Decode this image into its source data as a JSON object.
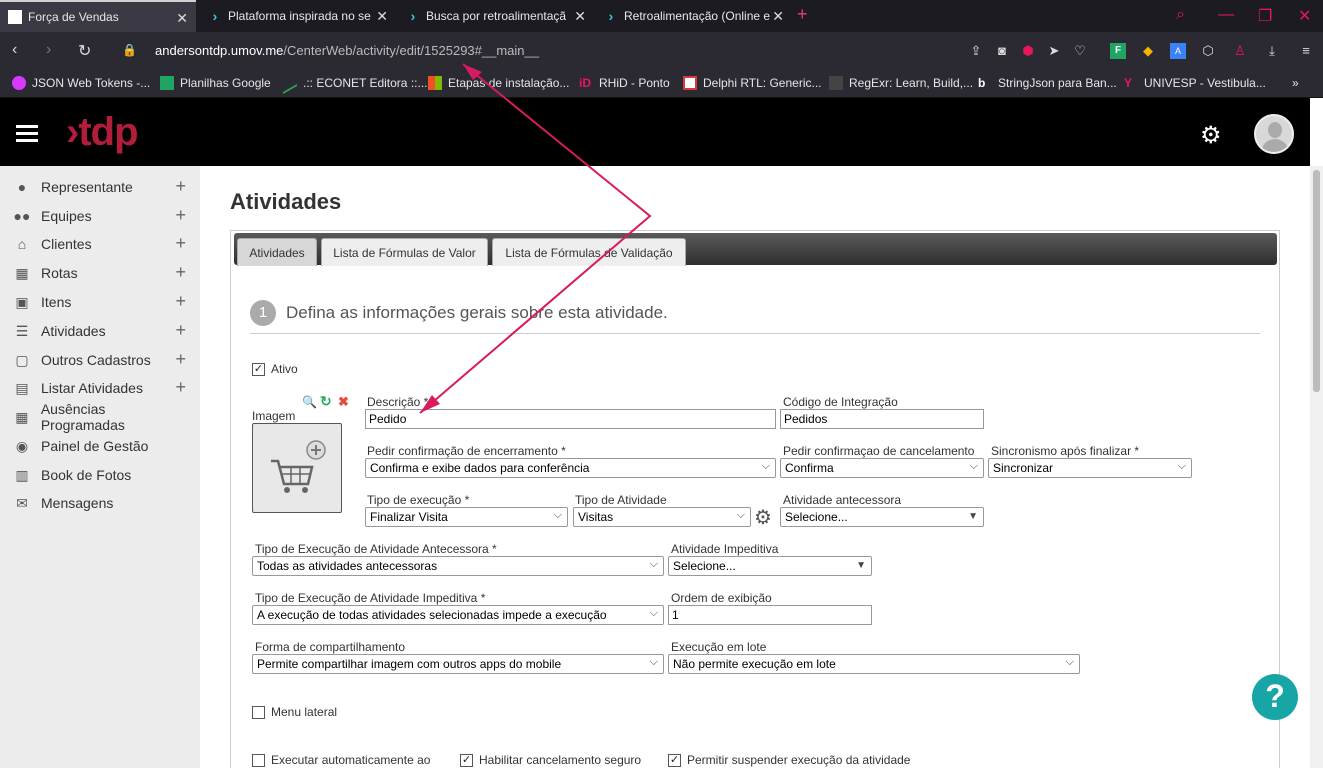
{
  "browser": {
    "tabs": [
      {
        "title": "Força de Vendas",
        "active": true
      },
      {
        "title": "Plataforma inspirada no se",
        "active": false
      },
      {
        "title": "Busca por retroalimentaçã",
        "active": false
      },
      {
        "title": "Retroalimentação (Online e",
        "active": false
      }
    ],
    "url_host": "andersontdp.umov.me",
    "url_path": "/CenterWeb/activity/edit/1525293#__main__",
    "bookmarks": [
      "JSON Web Tokens -...",
      "Planilhas Google",
      ".:: ECONET Editora ::...",
      "Etapas de instalação...",
      "RHiD - Ponto",
      "Delphi RTL: Generic...",
      "RegExr: Learn, Build,...",
      "StringJson para Ban...",
      "UNIVESP - Vestibula..."
    ]
  },
  "app": {
    "logo": "›tdp"
  },
  "sidebar": {
    "items": [
      {
        "label": "Representante",
        "icon": "person-icon",
        "has_plus": true
      },
      {
        "label": "Equipes",
        "icon": "group-icon",
        "has_plus": true
      },
      {
        "label": "Clientes",
        "icon": "home-icon",
        "has_plus": true
      },
      {
        "label": "Rotas",
        "icon": "map-icon",
        "has_plus": true
      },
      {
        "label": "Itens",
        "icon": "box-icon",
        "has_plus": true
      },
      {
        "label": "Atividades",
        "icon": "list-icon",
        "has_plus": true
      },
      {
        "label": "Outros Cadastros",
        "icon": "file-icon",
        "has_plus": true
      },
      {
        "label": "Listar Atividades",
        "icon": "clipboard-icon",
        "has_plus": true
      },
      {
        "label": "Ausências Programadas",
        "icon": "calendar-icon",
        "has_plus": false
      },
      {
        "label": "Painel de Gestão",
        "icon": "dashboard-icon",
        "has_plus": false
      },
      {
        "label": "Book de Fotos",
        "icon": "book-icon",
        "has_plus": false
      },
      {
        "label": "Mensagens",
        "icon": "mail-icon",
        "has_plus": false
      }
    ]
  },
  "main": {
    "title": "Atividades",
    "tabs": [
      "Atividades",
      "Lista de Fórmulas de Valor",
      "Lista de Fórmulas de Validação"
    ],
    "step_number": "1",
    "step_text": "Defina as informações gerais sobre esta atividade.",
    "ativo_label": "Ativo",
    "imagem_label": "Imagem",
    "fields": {
      "descricao": {
        "label": "Descrição *",
        "value": "Pedido"
      },
      "codigo": {
        "label": "Código de Integração",
        "value": "Pedidos"
      },
      "pedir_conf_enc": {
        "label": "Pedir confirmação de encerramento *",
        "value": "Confirma e exibe dados para conferência"
      },
      "pedir_conf_canc": {
        "label": "Pedir confirmaçao de cancelamento",
        "value": "Confirma"
      },
      "sincronismo": {
        "label": "Sincronismo após finalizar *",
        "value": "Sincronizar"
      },
      "tipo_exec": {
        "label": "Tipo de execução *",
        "value": "Finalizar Visita"
      },
      "tipo_ativ": {
        "label": "Tipo de Atividade",
        "value": "Visitas"
      },
      "ativ_antecessora": {
        "label": "Atividade antecessora",
        "value": "Selecione..."
      },
      "tipo_exec_antecessora": {
        "label": "Tipo de Execução de Atividade Antecessora *",
        "value": "Todas as atividades antecessoras"
      },
      "ativ_impeditiva": {
        "label": "Atividade Impeditiva",
        "value": "Selecione..."
      },
      "tipo_exec_impeditiva": {
        "label": "Tipo de Execução de Atividade Impeditiva *",
        "value": "A execução de todas atividades selecionadas impede a execução"
      },
      "ordem": {
        "label": "Ordem de exibição",
        "value": "1"
      },
      "compartilhamento": {
        "label": "Forma de compartilhamento",
        "value": "Permite compartilhar imagem com outros apps do mobile"
      },
      "exec_lote": {
        "label": "Execução em lote",
        "value": "Não permite execução em lote"
      }
    },
    "checkboxes": {
      "menu_lateral": "Menu lateral",
      "exec_auto": "Executar automaticamente ao",
      "cancel_seguro": "Habilitar cancelamento seguro",
      "suspender": "Permitir suspender execução da atividade"
    },
    "help": "?"
  },
  "colors": {
    "brand": "#b21d3c",
    "annotation": "#d81b60",
    "help": "#17a5a5"
  }
}
